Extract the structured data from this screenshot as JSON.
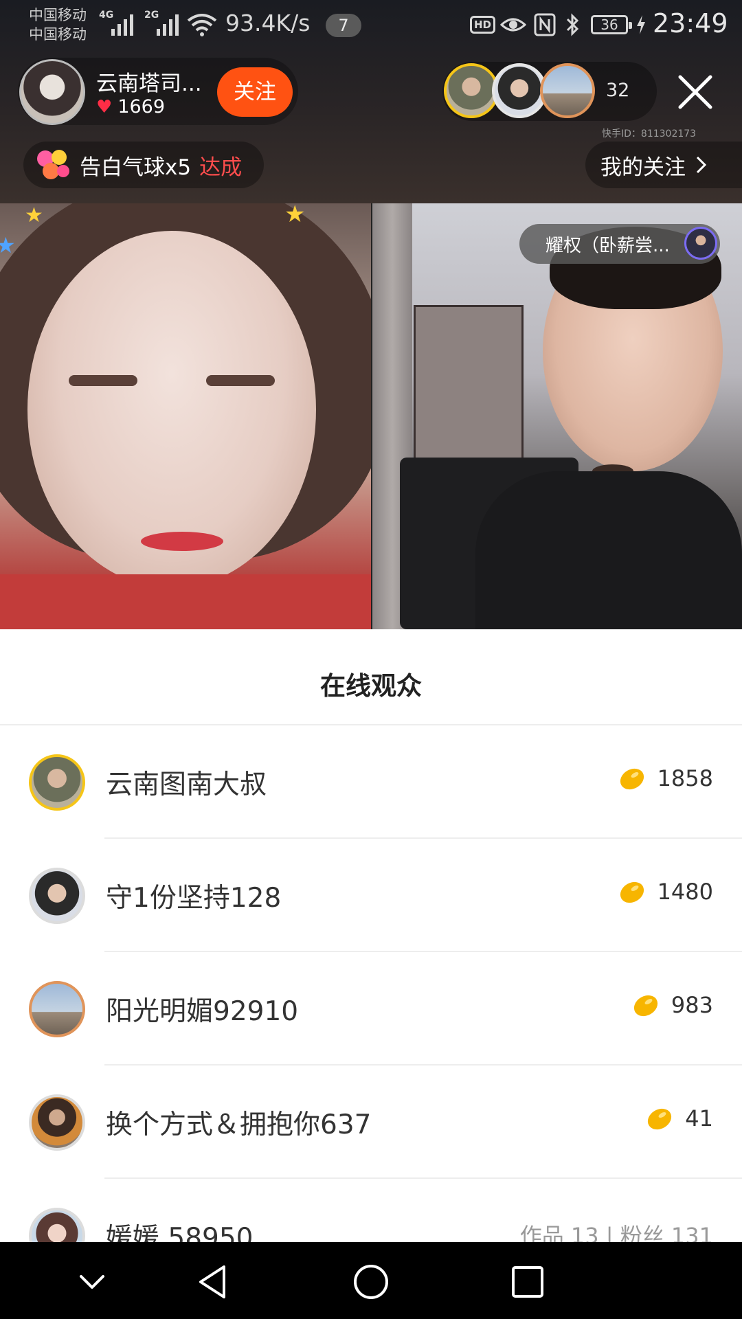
{
  "status_bar": {
    "carrier_1": "中国移动",
    "carrier_2": "中国移动",
    "signal_label_1": "4G",
    "signal_label_2": "2G",
    "net_speed": "93.4K/s",
    "notification_count": "7",
    "hd_label": "HD",
    "battery": "36",
    "time": "23:49"
  },
  "host": {
    "name": "云南塔司...",
    "likes": "1669",
    "follow_label": "关注"
  },
  "top_viewers": {
    "count": "32"
  },
  "kuaishou_id": "快手ID：811302173",
  "balloon_task": {
    "text": "告白气球x5",
    "status": "达成"
  },
  "my_follow_label": "我的关注",
  "guest": {
    "name": "耀权（卧薪尝..."
  },
  "sheet": {
    "title": "在线观众",
    "viewers": [
      {
        "name": "云南图南大叔",
        "score": "1858",
        "ring": "#f5c518"
      },
      {
        "name": "守1份坚持128",
        "score": "1480",
        "ring": "#dcdcdc"
      },
      {
        "name": "阳光明媚92910",
        "score": "983",
        "ring": "#e0945a"
      },
      {
        "name": "换个方式＆拥抱你637",
        "score": "41",
        "ring": "#dcdcdc"
      },
      {
        "name": "媛媛 58950",
        "extra": "作品 13 | 粉丝 131",
        "ring": "#dcdcdc"
      }
    ]
  },
  "colors": {
    "follow_button": "#ff5212",
    "achievement_text": "#ff4d4d",
    "coin": "#f7b500"
  },
  "icons": {
    "close": "close-icon",
    "coin": "gold-bean-icon",
    "nav": [
      "chevron-down-icon",
      "back-icon",
      "home-icon",
      "recents-icon"
    ]
  }
}
